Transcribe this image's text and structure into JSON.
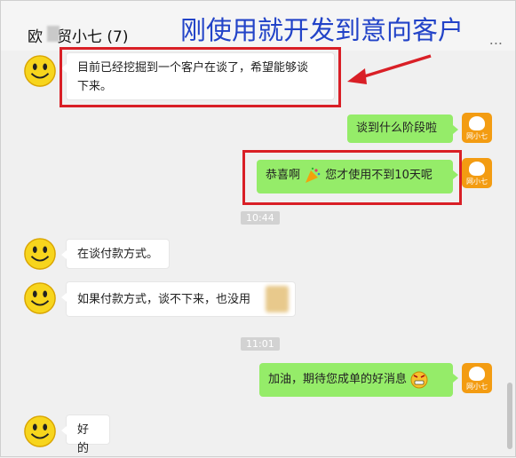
{
  "header": {
    "title": "欧",
    "title_rest": "贸小七 (7)",
    "more_label": "..."
  },
  "overlay": {
    "text": "刚使用就开发到意向客户"
  },
  "bot_avatar_label": "网小七",
  "messages": [
    {
      "side": "in",
      "text_line1": "目前已经挖掘到一个客户在谈了，希望能够谈",
      "text_line2": "下来。"
    },
    {
      "side": "out",
      "text": "谈到什么阶段啦"
    },
    {
      "side": "out",
      "text_a": "恭喜啊",
      "text_b": "您才使用不到10天呢"
    },
    {
      "side": "time",
      "text": "10:44"
    },
    {
      "side": "in",
      "text": "在谈付款方式。"
    },
    {
      "side": "in",
      "text": "如果付款方式，谈不下来，也没用"
    },
    {
      "side": "time",
      "text": "11:01"
    },
    {
      "side": "out",
      "text": "加油，期待您成单的好消息"
    },
    {
      "side": "in",
      "text": "好的"
    }
  ],
  "colors": {
    "accent_red": "#d91f26",
    "overlay_blue": "#2243c8",
    "bubble_green": "#95ec69",
    "bot_orange": "#f39c12"
  },
  "icons": [
    "smiley-avatar-icon",
    "bot-avatar-icon",
    "party-popper-icon",
    "grinning-face-icon",
    "blurred-image-icon",
    "arrow-icon"
  ]
}
